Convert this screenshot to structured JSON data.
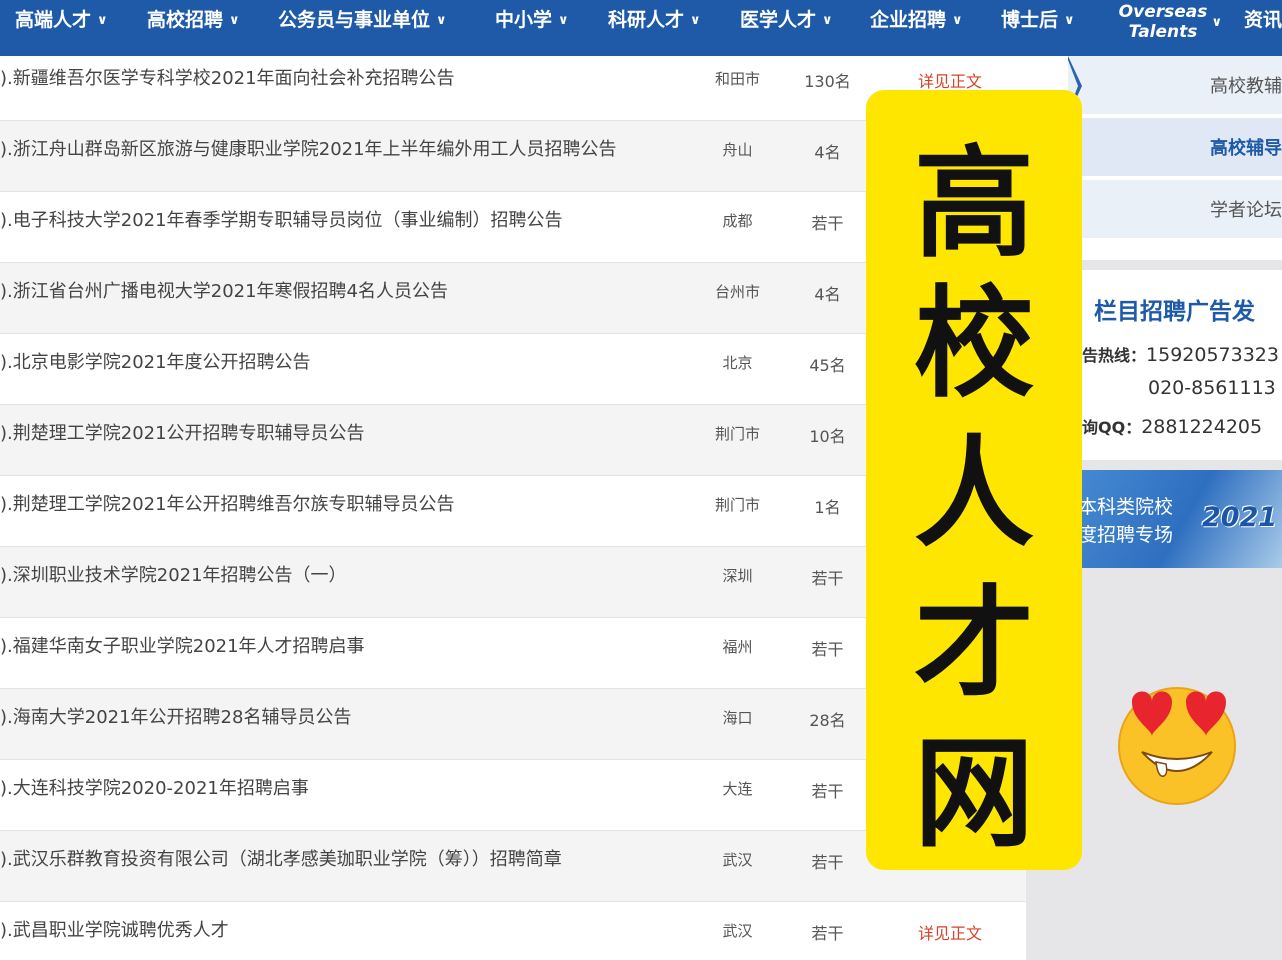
{
  "nav": {
    "items": [
      {
        "label": "高端人才"
      },
      {
        "label": "高校招聘"
      },
      {
        "label": "公务员与事业单位"
      },
      {
        "label": "中小学"
      },
      {
        "label": "科研人才"
      },
      {
        "label": "医学人才"
      },
      {
        "label": "企业招聘"
      },
      {
        "label": "博士后"
      }
    ],
    "overseas_line1": "Overseas",
    "overseas_line2": "Talents",
    "last_partial": "资讯",
    "chevron": "∨"
  },
  "jobs": [
    {
      "title": ").新疆维吾尔医学专科学校2021年面向社会补充招聘公告",
      "city": "和田市",
      "count": "130名",
      "detail": "详见正文"
    },
    {
      "title": ").浙江舟山群岛新区旅游与健康职业学院2021年上半年编外用工人员招聘公告",
      "city": "舟山",
      "count": "4名",
      "detail": ""
    },
    {
      "title": ").电子科技大学2021年春季学期专职辅导员岗位（事业编制）招聘公告",
      "city": "成都",
      "count": "若干",
      "detail": ""
    },
    {
      "title": ").浙江省台州广播电视大学2021年寒假招聘4名人员公告",
      "city": "台州市",
      "count": "4名",
      "detail": ""
    },
    {
      "title": ").北京电影学院2021年度公开招聘公告",
      "city": "北京",
      "count": "45名",
      "detail": ""
    },
    {
      "title": ").荆楚理工学院2021公开招聘专职辅导员公告",
      "city": "荆门市",
      "count": "10名",
      "detail": ""
    },
    {
      "title": ").荆楚理工学院2021年公开招聘维吾尔族专职辅导员公告",
      "city": "荆门市",
      "count": "1名",
      "detail": ""
    },
    {
      "title": ").深圳职业技术学院2021年招聘公告（一）",
      "city": "深圳",
      "count": "若干",
      "detail": ""
    },
    {
      "title": ").福建华南女子职业学院2021年人才招聘启事",
      "city": "福州",
      "count": "若干",
      "detail": ""
    },
    {
      "title": ").海南大学2021年公开招聘28名辅导员公告",
      "city": "海口",
      "count": "28名",
      "detail": ""
    },
    {
      "title": ").大连科技学院2020-2021年招聘启事",
      "city": "大连",
      "count": "若干",
      "detail": ""
    },
    {
      "title": ").武汉乐群教育投资有限公司（湖北孝感美珈职业学院（筹））招聘简章",
      "city": "武汉",
      "count": "若干",
      "detail": ""
    },
    {
      "title": ").武昌职业学院诚聘优秀人才",
      "city": "武汉",
      "count": "若干",
      "detail": "详见正文"
    }
  ],
  "sidebar": {
    "menu": [
      {
        "label": "高校教辅"
      },
      {
        "label": "高校辅导"
      },
      {
        "label": "学者论坛"
      }
    ],
    "ad": {
      "title": "栏目招聘广告发",
      "hotline_key": "告热线：",
      "hotline_1": "15920573323",
      "hotline_2": "020-8561113",
      "qq_key": "询QQ：",
      "qq": "2881224205"
    },
    "banner": {
      "line1": "本科类院校",
      "line2": "度招聘专场",
      "year": "2021"
    }
  },
  "overlay": {
    "chars": [
      "高",
      "校",
      "人",
      "才",
      "网"
    ]
  },
  "colors": {
    "nav_bg": "#1f5aa8",
    "detail_red": "#d6422b",
    "overlay_yellow": "#ffe600",
    "accent_blue": "#1f5aa8"
  }
}
